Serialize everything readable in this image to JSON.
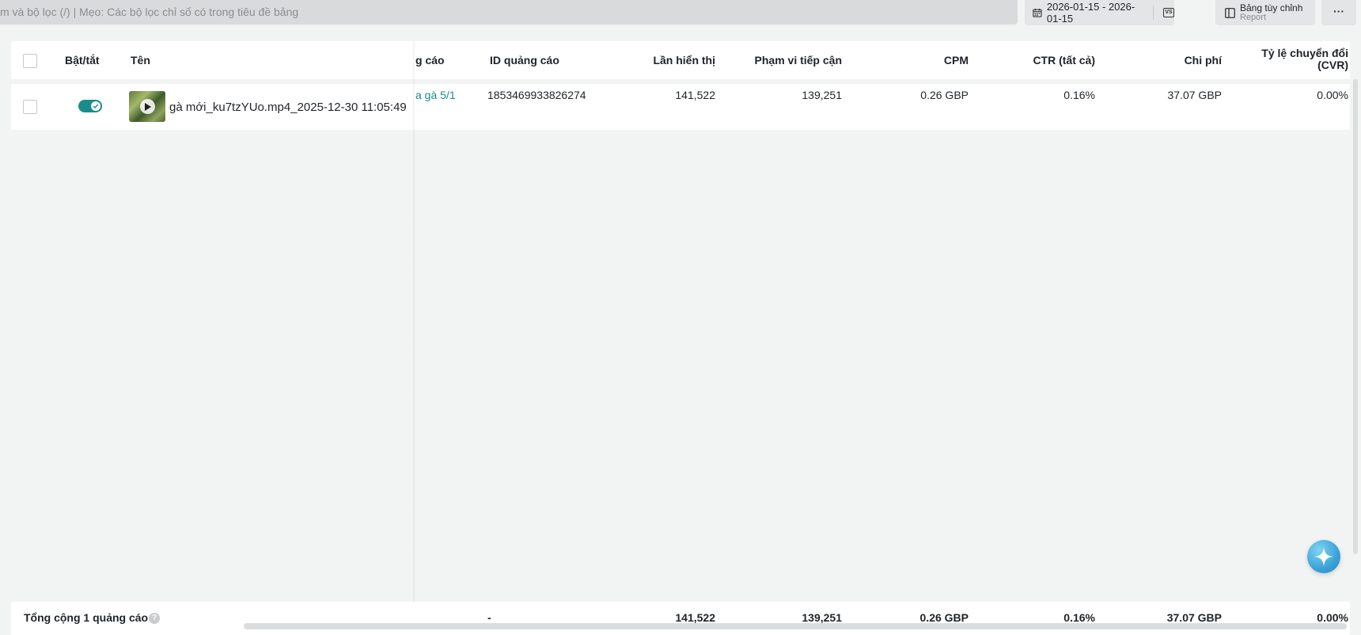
{
  "toolbar": {
    "search_placeholder": "m và bộ lọc (/) | Mẹo: Các bộ lọc chỉ số có trong tiêu đề bảng",
    "date_range": "2026-01-15 - 2026-01-15",
    "compare_label": "VS",
    "custom_table_label": "Bảng tùy chỉnh",
    "custom_table_sub": "Report",
    "more_label": "···"
  },
  "table": {
    "headers": {
      "toggle": "Bật/tắt",
      "name": "Tên",
      "ad_group": "g cáo",
      "ad_id": "ID quảng cáo",
      "impressions": "Lần hiển thị",
      "reach": "Phạm vi tiếp cận",
      "cpm": "CPM",
      "ctr": "CTR (tất cả)",
      "cost": "Chi phí",
      "cvr_line1": "Tỷ lệ chuyển đổi",
      "cvr_line2": "(CVR)"
    },
    "rows": [
      {
        "enabled": true,
        "name": "gà mới_ku7tzYUo.mp4_2025-12-30 11:05:49",
        "ad_group": "a gà 5/1",
        "ad_id": "1853469933826274",
        "impressions": "141,522",
        "reach": "139,251",
        "cpm": "0.26 GBP",
        "ctr": "0.16%",
        "cost": "37.07 GBP",
        "cvr": "0.00%"
      }
    ],
    "footer": {
      "label": "Tổng cộng 1 quảng cáo",
      "help": "?",
      "ad_id": "-",
      "impressions": "141,522",
      "reach": "139,251",
      "cpm": "0.26 GBP",
      "ctr": "0.16%",
      "cost": "37.07 GBP",
      "cvr": "0.00%"
    }
  },
  "colors": {
    "accent": "#1a8c8c",
    "background": "#f2f3f3"
  }
}
